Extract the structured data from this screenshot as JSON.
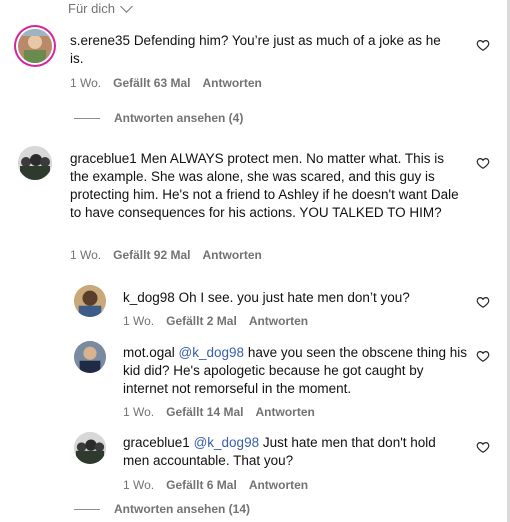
{
  "top": {
    "label": "Für dich"
  },
  "comments": [
    {
      "username": "s.erene35",
      "text": "Defending him? You’re just as much of a joke as he is.",
      "time": "1 Wo.",
      "likes": "Gefällt 63 Mal",
      "reply": "Antworten",
      "view_replies": "Antworten ansehen (4)"
    },
    {
      "username": "graceblue1",
      "text": "Men ALWAYS protect men. No matter what. This is the example. She was alone, she was scared, and this guy is protecting him. He's not a friend to Ashley if he doesn't want Dale to have consequences for his actions. YOU TALKED TO HIM?",
      "time": "1 Wo.",
      "likes": "Gefällt 92 Mal",
      "reply": "Antworten"
    }
  ],
  "replies": [
    {
      "username": "k_dog98",
      "text": "Oh I see. you just hate men don’t you?",
      "time": "1 Wo.",
      "likes": "Gefällt 2 Mal",
      "reply": "Antworten"
    },
    {
      "username": "mot.ogal",
      "mention": "@k_dog98",
      "text": "have you seen the obscene thing his kid did? He's apologetic because he got caught by internet not remorseful in the moment.",
      "time": "1 Wo.",
      "likes": "Gefällt 14 Mal",
      "reply": "Antworten"
    },
    {
      "username": "graceblue1",
      "mention": "@k_dog98",
      "text": "Just hate men that don't hold men accountable. That you?",
      "time": "1 Wo.",
      "likes": "Gefällt 6 Mal",
      "reply": "Antworten"
    }
  ],
  "bottom": {
    "view_replies": "Antworten ansehen (14)"
  },
  "icons": {
    "like": "heart-outline-icon",
    "dropdown": "chevron-down-icon"
  }
}
